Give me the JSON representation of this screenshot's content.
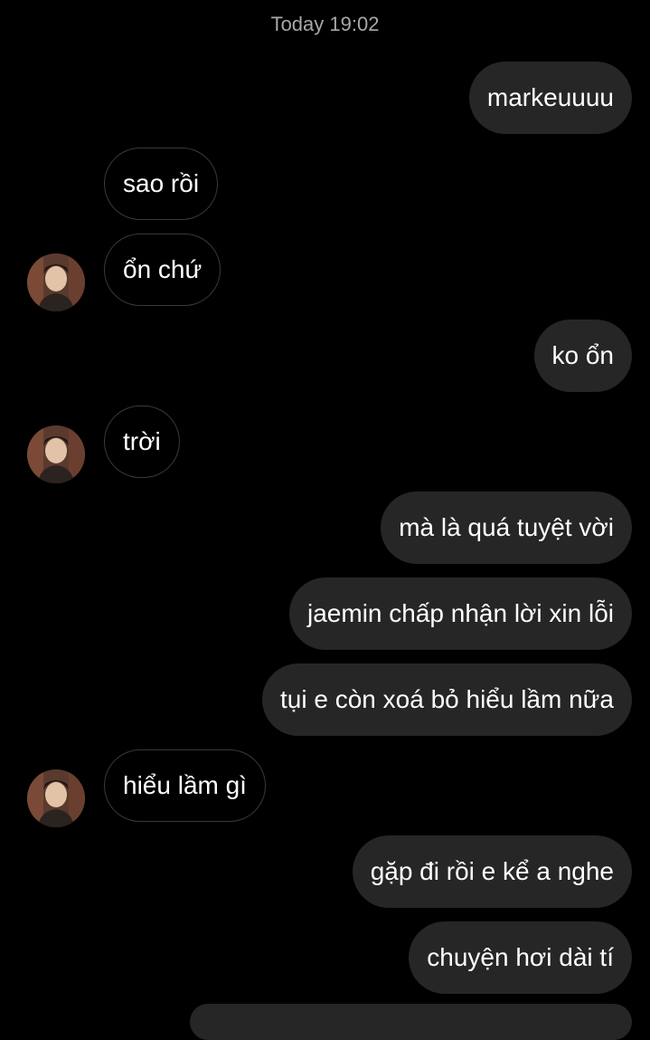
{
  "chat": {
    "timestamp": "Today 19:02",
    "messages": [
      {
        "sender": "me",
        "text": "markeuuuu"
      },
      {
        "sender": "them",
        "text": "sao rồi"
      },
      {
        "sender": "them",
        "text": "ổn chứ"
      },
      {
        "sender": "me",
        "text": "ko ổn"
      },
      {
        "sender": "them",
        "text": "trời"
      },
      {
        "sender": "me",
        "text": "mà là quá tuyệt vời"
      },
      {
        "sender": "me",
        "text": "jaemin chấp nhận lời xin lỗi"
      },
      {
        "sender": "me",
        "text": "tụi e còn xoá bỏ hiểu lầm nữa"
      },
      {
        "sender": "them",
        "text": "hiểu lầm gì"
      },
      {
        "sender": "me",
        "text": "gặp đi rồi e kể a nghe"
      },
      {
        "sender": "me",
        "text": "chuyện hơi dài tí"
      }
    ]
  },
  "colors": {
    "background": "#000000",
    "outgoing_bubble": "#262626",
    "incoming_border": "#3a3a3a",
    "timestamp_text": "#a8a8a8"
  }
}
